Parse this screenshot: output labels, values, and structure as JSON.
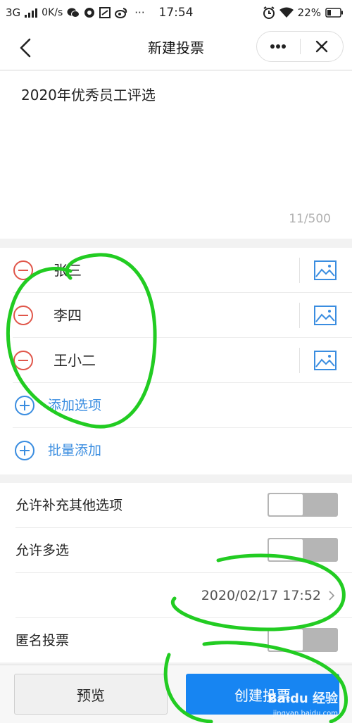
{
  "status_bar": {
    "network": "3G",
    "speed": "0K/s",
    "time": "17:54",
    "battery": "22%",
    "more": "···"
  },
  "nav": {
    "title": "新建投票"
  },
  "vote": {
    "title": "2020年优秀员工评选",
    "char_count": "11/500"
  },
  "options": [
    {
      "label": "张三"
    },
    {
      "label": "李四"
    },
    {
      "label": "王小二"
    }
  ],
  "add_option_label": "添加选项",
  "batch_add_label": "批量添加",
  "settings": {
    "allow_other_label": "允许补充其他选项",
    "allow_multi_label": "允许多选",
    "deadline": "2020/02/17 17:52",
    "anonymous_label": "匿名投票"
  },
  "buttons": {
    "preview": "预览",
    "create": "创建投票"
  },
  "watermark": {
    "brand": "Baidu 经验",
    "url": "jingyan.baidu.com"
  },
  "colors": {
    "accent": "#1785f2",
    "danger": "#e0564a",
    "link": "#3a8de0",
    "annotation": "#22cc22"
  },
  "icons": [
    "signal-icon",
    "wechat-icon",
    "weibo-icon",
    "alarm-icon",
    "wifi-icon",
    "battery-icon",
    "back-icon",
    "more-icon",
    "close-icon",
    "minus-circle-icon",
    "image-icon",
    "plus-circle-icon",
    "chevron-right-icon"
  ]
}
